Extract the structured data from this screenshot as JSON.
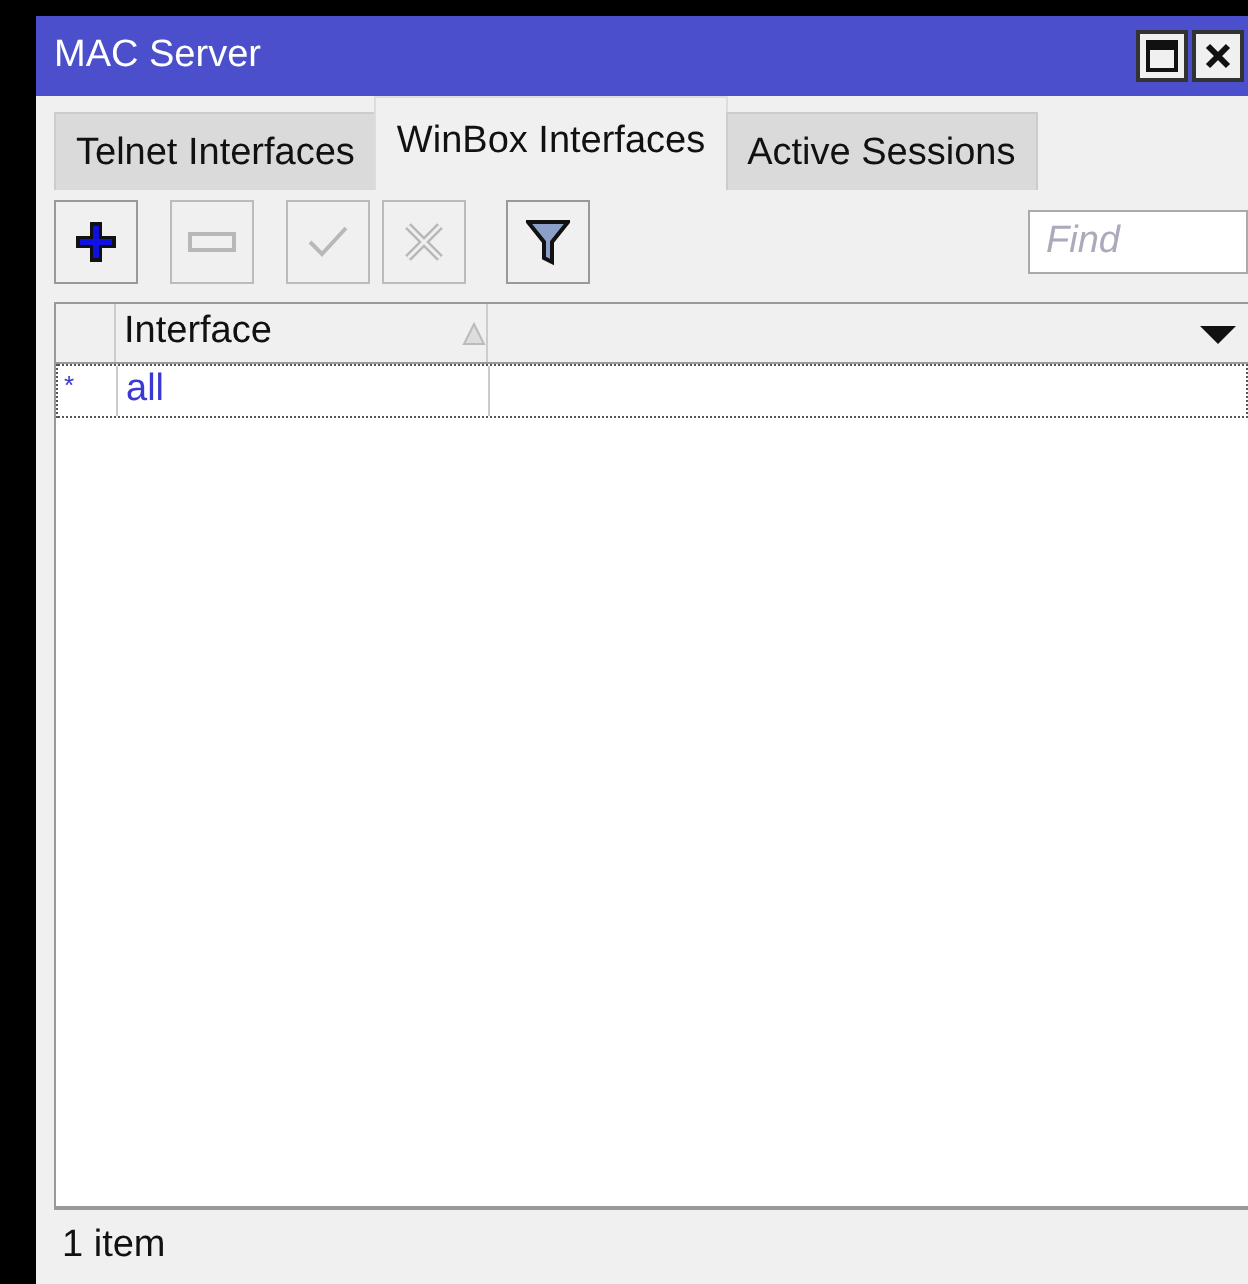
{
  "window": {
    "title": "MAC Server"
  },
  "tabs": [
    {
      "label": "Telnet Interfaces",
      "selected": false
    },
    {
      "label": "WinBox Interfaces",
      "selected": true
    },
    {
      "label": "Active Sessions",
      "selected": false
    }
  ],
  "toolbar": [
    {
      "kind": "add",
      "disabled": false
    },
    {
      "kind": "remove",
      "disabled": true
    },
    {
      "kind": "enable",
      "disabled": true
    },
    {
      "kind": "disable",
      "disabled": true
    },
    {
      "kind": "filter",
      "disabled": false
    }
  ],
  "search": {
    "placeholder": "Find"
  },
  "table": {
    "columns": [
      "Interface"
    ],
    "rows": [
      {
        "flag": "*",
        "cells": [
          "all"
        ],
        "selected": true
      }
    ]
  },
  "status_bar": "1 item"
}
